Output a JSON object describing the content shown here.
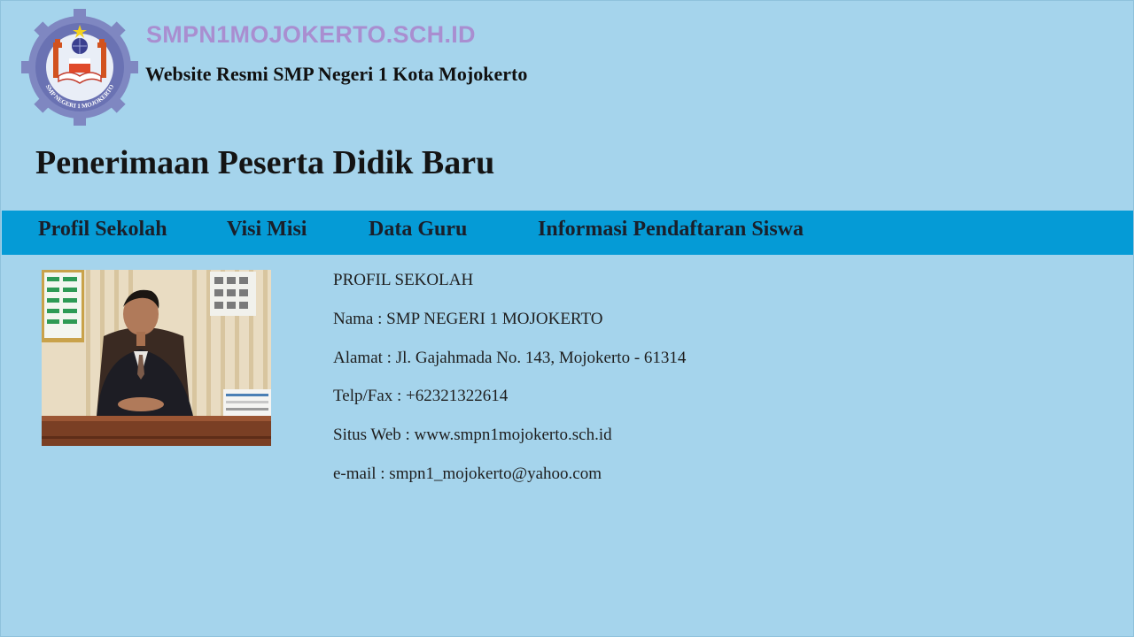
{
  "header": {
    "logo_icon": "school-emblem-icon",
    "logo_ring_text": "SMP NEGERI 1 MOJOKERTO",
    "site_domain": "SMPN1MOJOKERTO.SCH.ID",
    "tagline": "Website Resmi SMP Negeri 1 Kota Mojokerto"
  },
  "page_title": "Penerimaan Peserta Didik Baru",
  "nav": {
    "items": [
      {
        "label": "Profil Sekolah"
      },
      {
        "label": "Visi Misi"
      },
      {
        "label": "Data Guru"
      },
      {
        "label": "Informasi Pendaftaran Siswa"
      }
    ]
  },
  "profile": {
    "photo_icon": "principal-photo",
    "heading": "PROFIL SEKOLAH",
    "lines": [
      "Nama : SMP NEGERI 1 MOJOKERTO",
      "Alamat : Jl. Gajahmada No. 143, Mojokerto - 61314",
      "Telp/Fax : +62321322614",
      "Situs Web : www.smpn1mojokerto.sch.id",
      "e-mail : smpn1_mojokerto@yahoo.com"
    ]
  },
  "colors": {
    "background": "#a5d4ec",
    "navbar": "#059bd6",
    "domain_text": "#a98ed0"
  }
}
